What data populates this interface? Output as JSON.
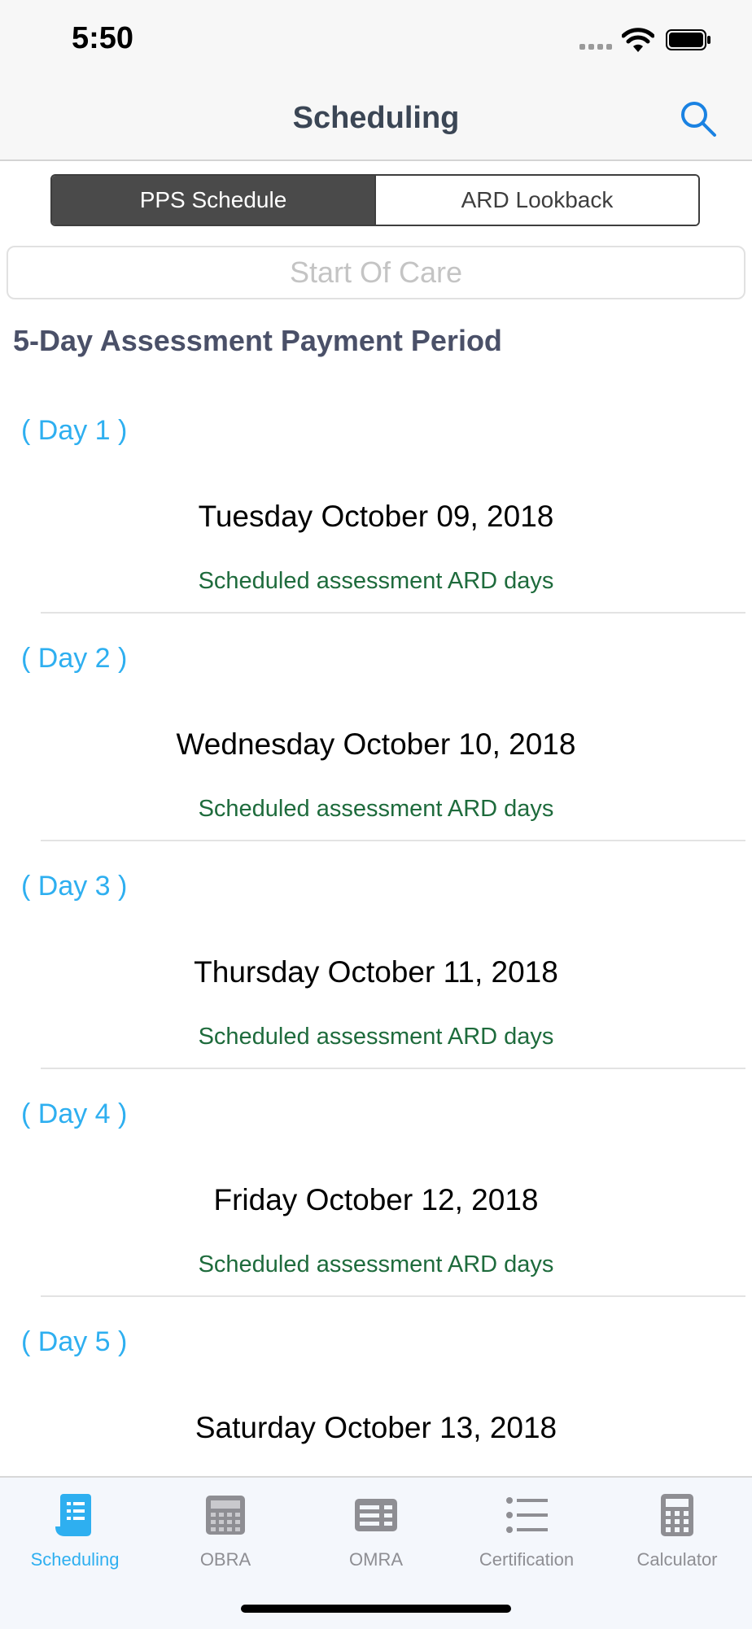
{
  "status_bar": {
    "time": "5:50"
  },
  "nav": {
    "title": "Scheduling"
  },
  "segments": {
    "pps_label": "PPS Schedule",
    "ard_label": "ARD Lookback"
  },
  "start_field": {
    "placeholder": "Start Of Care"
  },
  "section": {
    "title": "5-Day Assessment Payment Period"
  },
  "days": [
    {
      "label": "( Day  1 )",
      "date": "Tuesday October 09, 2018",
      "note": "Scheduled assessment ARD days"
    },
    {
      "label": "( Day  2 )",
      "date": "Wednesday October 10, 2018",
      "note": "Scheduled assessment ARD days"
    },
    {
      "label": "( Day  3 )",
      "date": "Thursday October 11, 2018",
      "note": "Scheduled assessment ARD days"
    },
    {
      "label": "( Day  4 )",
      "date": "Friday October 12, 2018",
      "note": "Scheduled assessment ARD days"
    },
    {
      "label": "( Day  5 )",
      "date": "Saturday October 13, 2018"
    }
  ],
  "tabs": {
    "scheduling": "Scheduling",
    "obra": "OBRA",
    "omra": "OMRA",
    "certification": "Certification",
    "calculator": "Calculator"
  },
  "colors": {
    "accent": "#2EAFF0",
    "note_green": "#1E6B3C",
    "title_slate": "#3B4655"
  }
}
